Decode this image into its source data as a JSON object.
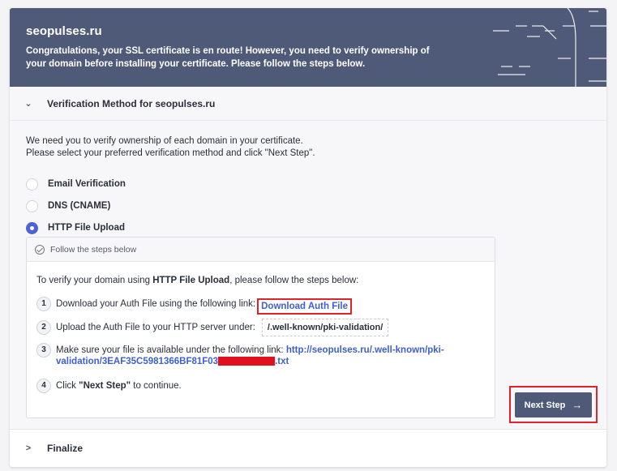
{
  "banner": {
    "domain": "seopulses.ru",
    "message": "Congratulations, your SSL certificate is en route! However, you need to verify ownership of your domain before installing your certificate. Please follow the steps below."
  },
  "verification_section": {
    "chevron": "v",
    "title": "Verification Method for seopulses.ru",
    "intro_line1": "We need you to verify ownership of each domain in your certificate.",
    "intro_line2": "Please select your preferred verification method and click \"Next Step\".",
    "options": [
      {
        "label": "Email Verification",
        "selected": false
      },
      {
        "label": "DNS (CNAME)",
        "selected": false
      },
      {
        "label": "HTTP File Upload",
        "selected": true
      }
    ]
  },
  "steps": {
    "header": "Follow the steps below",
    "intro_prefix": "To verify your domain using ",
    "intro_bold": "HTTP File Upload",
    "intro_suffix": ", please follow the steps below:",
    "step1_num": "1",
    "step1_text": "Download your Auth File using the following link:",
    "step1_link": "Download Auth File",
    "step2_num": "2",
    "step2_text": "Upload the Auth File to your HTTP server under:",
    "step2_path": "/.well-known/pki-validation/",
    "step3_num": "3",
    "step3_text": "Make sure your file is available under the following link:",
    "step3_link_line1": "http://seopulses.ru/.well-known/pki-",
    "step3_link_line2_start": "validation/3EAF35C5981366BF81F03",
    "step3_link_line2_end": ".txt",
    "step4_num": "4",
    "step4_prefix": "Click ",
    "step4_bold": "\"Next Step\"",
    "step4_suffix": " to continue."
  },
  "next_button": {
    "label": "Next Step",
    "arrow": "→"
  },
  "finalize_section": {
    "chevron": ">",
    "title": "Finalize"
  },
  "colors": {
    "banner": "#4f5a78",
    "accent": "#4a63d6",
    "highlight": "#e0222b"
  }
}
